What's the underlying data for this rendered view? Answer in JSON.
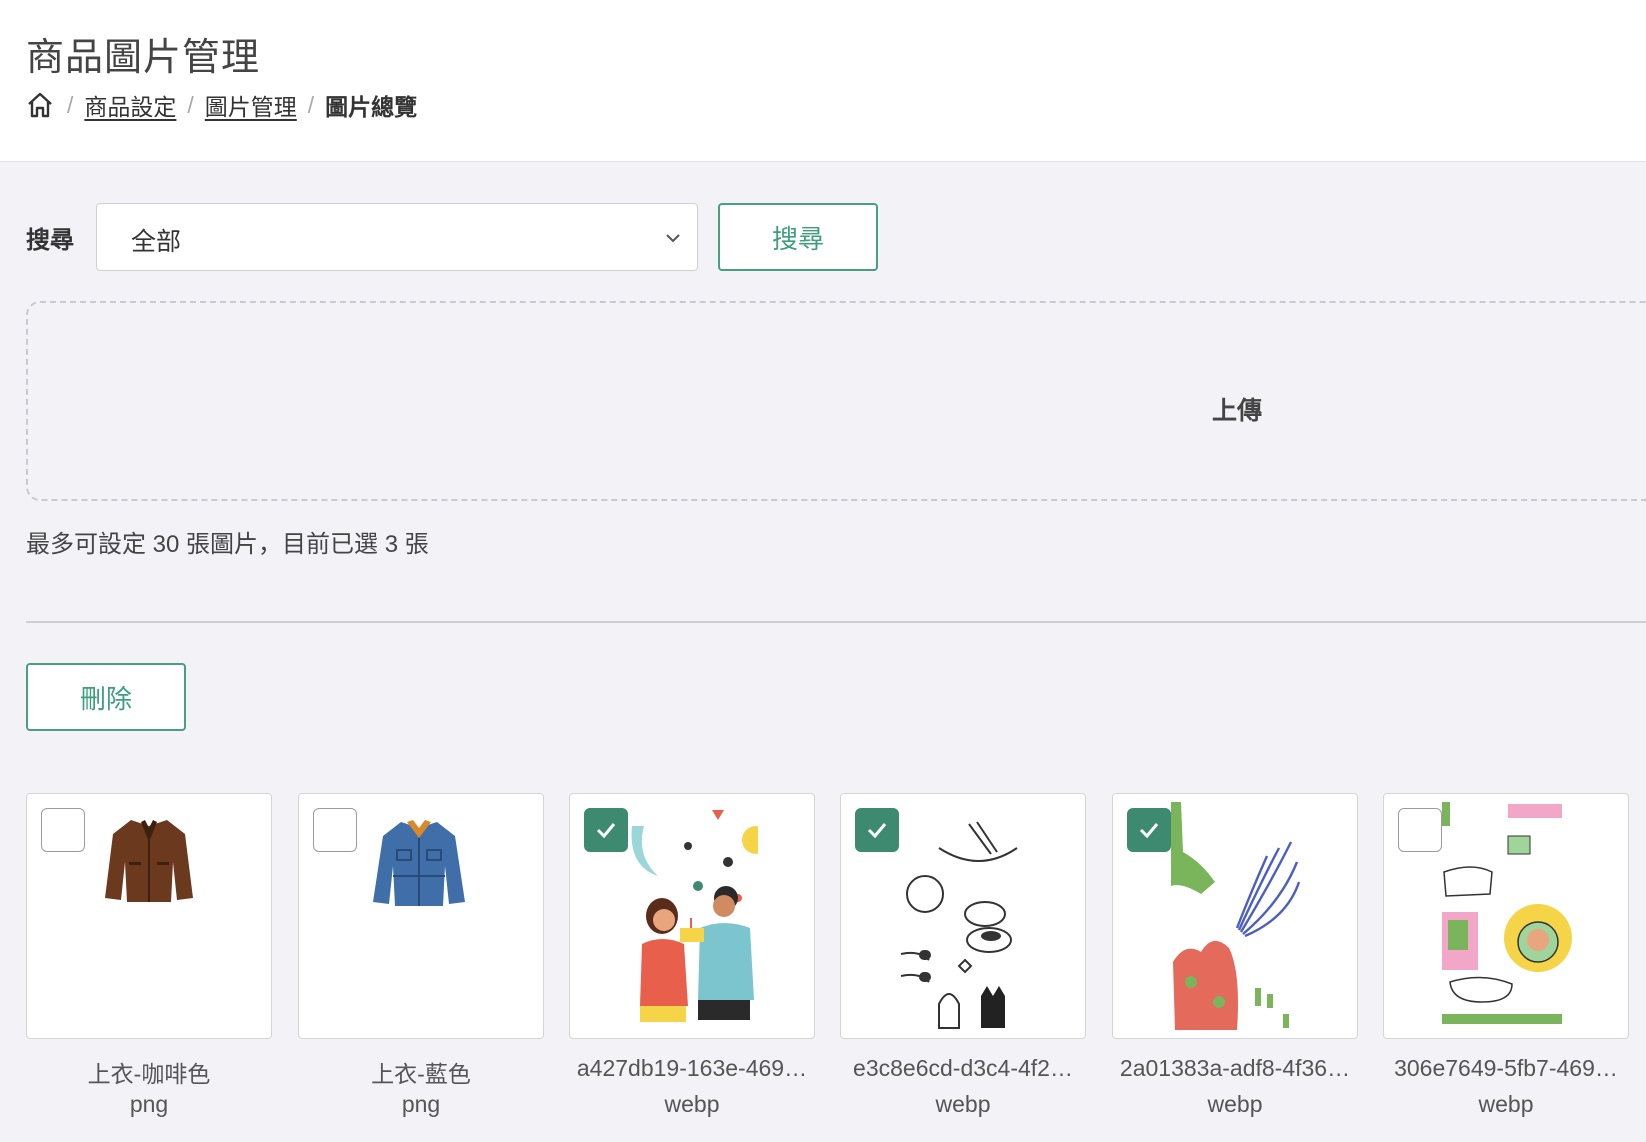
{
  "header": {
    "title": "商品圖片管理",
    "breadcrumb": {
      "home_icon": "home-icon",
      "separator": "/",
      "items": [
        "商品設定",
        "圖片管理"
      ],
      "current": "圖片總覽"
    }
  },
  "search": {
    "label": "搜尋",
    "selected": "全部",
    "button": "搜尋"
  },
  "upload": {
    "label": "上傳"
  },
  "limit_text": "最多可設定 30 張圖片，目前已選 3 張",
  "actions": {
    "delete": "刪除"
  },
  "colors": {
    "accent": "#3f9e7d",
    "checked": "#3e8a70"
  },
  "images": [
    {
      "name": "上衣-咖啡色",
      "ext": "png",
      "checked": false
    },
    {
      "name": "上衣-藍色",
      "ext": "png",
      "checked": false
    },
    {
      "name": "a427db19-163e-469…",
      "ext": "webp",
      "checked": true
    },
    {
      "name": "e3c8e6cd-d3c4-4f2…",
      "ext": "webp",
      "checked": true
    },
    {
      "name": "2a01383a-adf8-4f36…",
      "ext": "webp",
      "checked": true
    },
    {
      "name": "306e7649-5fb7-469…",
      "ext": "webp",
      "checked": false
    }
  ]
}
